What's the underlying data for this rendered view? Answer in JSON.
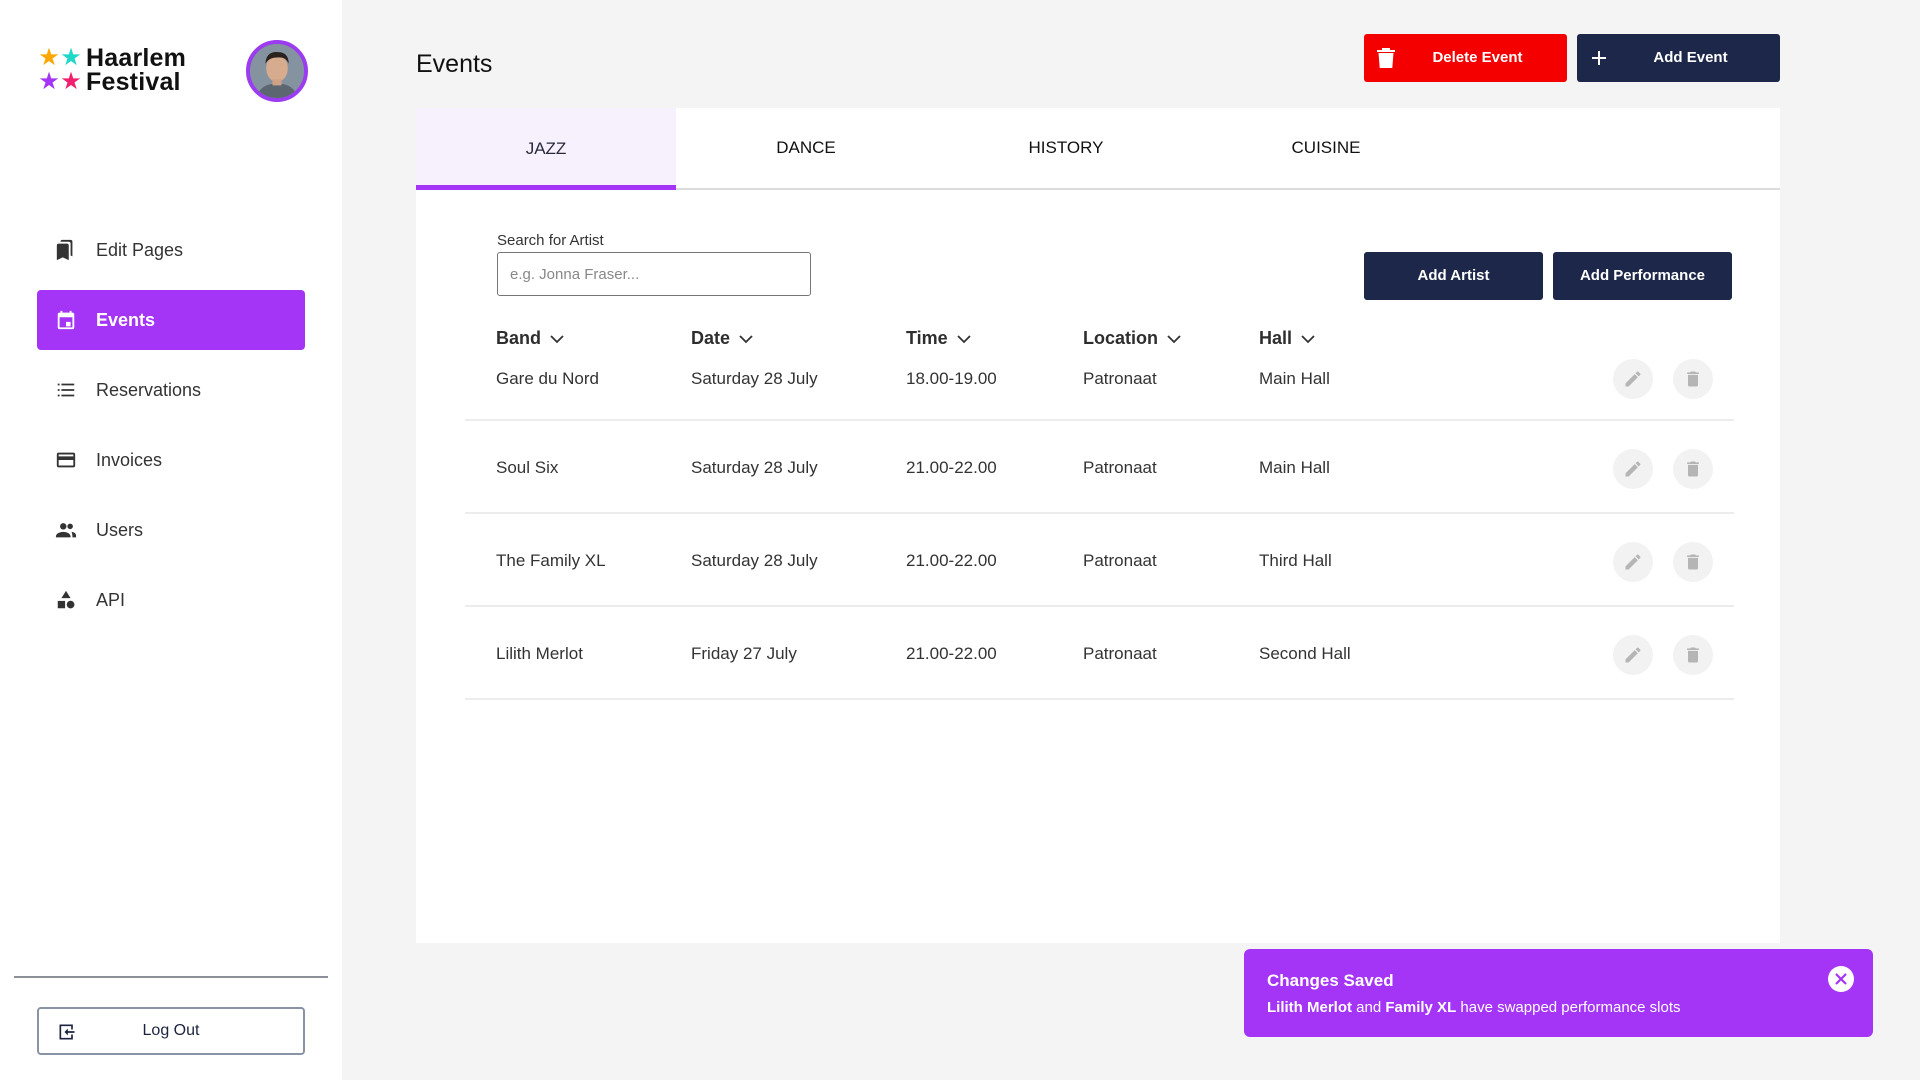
{
  "app": {
    "logo_line1": "Haarlem",
    "logo_line2": "Festival",
    "logo_star_colors": [
      "#ffa600",
      "#1fd8c8",
      "#a435f7",
      "#f0206e"
    ],
    "avatar_alt": "User avatar"
  },
  "sidebar": {
    "items": [
      {
        "label": "Edit Pages",
        "icon": "bookmarks-icon",
        "active": false
      },
      {
        "label": "Events",
        "icon": "calendar-icon",
        "active": true
      },
      {
        "label": "Reservations",
        "icon": "list-icon",
        "active": false
      },
      {
        "label": "Invoices",
        "icon": "credit-card-icon",
        "active": false
      },
      {
        "label": "Users",
        "icon": "users-icon",
        "active": false
      },
      {
        "label": "API",
        "icon": "shapes-icon",
        "active": false
      }
    ],
    "logout_label": "Log Out"
  },
  "header": {
    "title": "Events",
    "delete_event_label": "Delete Event",
    "add_event_label": "Add Event"
  },
  "tabs": [
    {
      "label": "JAZZ",
      "active": true
    },
    {
      "label": "DANCE",
      "active": false
    },
    {
      "label": "HISTORY",
      "active": false
    },
    {
      "label": "CUISINE",
      "active": false
    }
  ],
  "search": {
    "label": "Search for Artist",
    "placeholder": "e.g. Jonna Fraser...",
    "value": ""
  },
  "actions": {
    "add_artist_label": "Add Artist",
    "add_performance_label": "Add Performance"
  },
  "table": {
    "columns": [
      "Band",
      "Date",
      "Time",
      "Location",
      "Hall"
    ],
    "rows": [
      {
        "band": "Gare du Nord",
        "date": "Saturday 28 July",
        "time": "18.00-19.00",
        "location": "Patronaat",
        "hall": "Main Hall"
      },
      {
        "band": "Soul Six",
        "date": "Saturday 28 July",
        "time": "21.00-22.00",
        "location": "Patronaat",
        "hall": "Main Hall"
      },
      {
        "band": "The Family XL",
        "date": "Saturday 28 July",
        "time": "21.00-22.00",
        "location": "Patronaat",
        "hall": "Third Hall"
      },
      {
        "band": "Lilith Merlot",
        "date": "Friday 27 July",
        "time": "21.00-22.00",
        "location": "Patronaat",
        "hall": "Second Hall"
      }
    ]
  },
  "toast": {
    "title": "Changes Saved",
    "name1": "Lilith Merlot",
    "connector": " and ",
    "name2": "Family XL",
    "rest": " have swapped performance slots"
  },
  "colors": {
    "accent": "#a435f7",
    "navy": "#1d2749",
    "danger": "#f50000"
  }
}
